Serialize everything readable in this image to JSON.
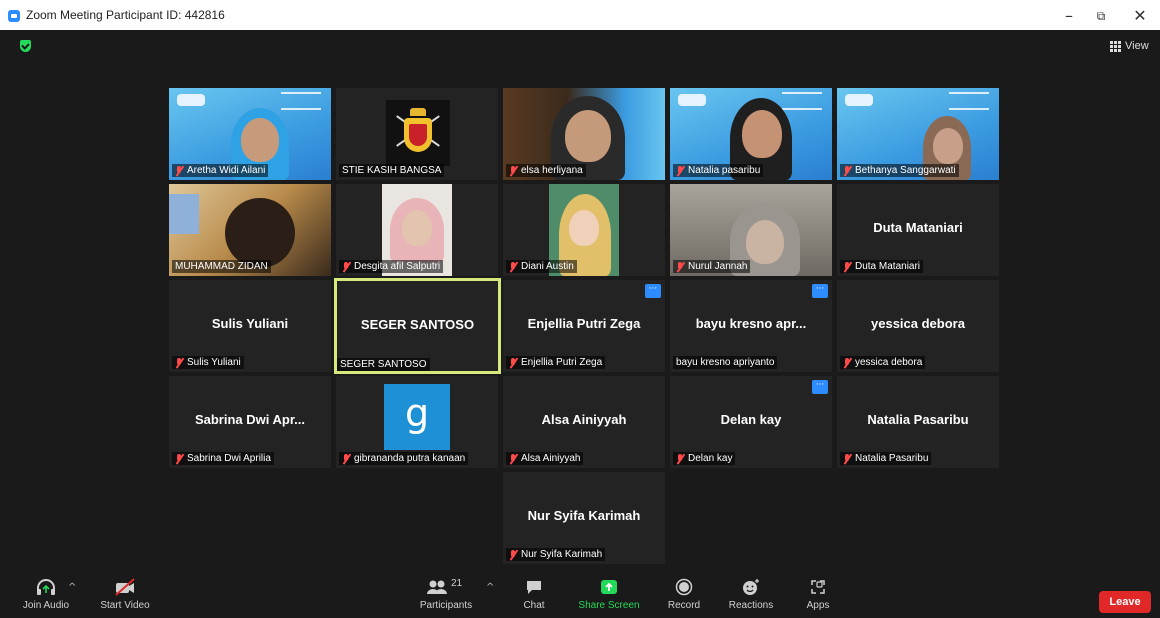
{
  "window": {
    "title": "Zoom Meeting Participant ID: 442816",
    "controls": {
      "minimize": "–",
      "restore": "⧉",
      "close": "✕"
    }
  },
  "header": {
    "view_label": "View"
  },
  "participants": [
    {
      "label": "Aretha Widi Ailani",
      "muted": true,
      "video": "slide"
    },
    {
      "label": "STIE KASIH BANGSA",
      "muted": false,
      "video": "emblem"
    },
    {
      "label": "elsa herliyana",
      "muted": true,
      "video": "camera"
    },
    {
      "label": "Natalia pasaribu",
      "muted": true,
      "video": "slide"
    },
    {
      "label": "Bethanya Sanggarwati",
      "muted": true,
      "video": "slide"
    },
    {
      "label": "MUHAMMAD ZIDAN",
      "muted": false,
      "video": "camera"
    },
    {
      "label": "Desgita afil Salputri",
      "muted": true,
      "video": "camera"
    },
    {
      "label": "Diani Austin",
      "muted": true,
      "video": "camera"
    },
    {
      "label": "Nurul Jannah",
      "muted": true,
      "video": "camera"
    },
    {
      "display_name": "Duta Mataniari",
      "label": "Duta Mataniari",
      "muted": true
    },
    {
      "display_name": "Sulis Yuliani",
      "label": "Sulis Yuliani",
      "muted": true
    },
    {
      "display_name": "SEGER SANTOSO",
      "label": "SEGER SANTOSO",
      "muted": false,
      "active_speaker": true
    },
    {
      "display_name": "Enjellia Putri Zega",
      "label": "Enjellia Putri Zega",
      "muted": true,
      "more_button": "···"
    },
    {
      "display_name": "bayu kresno apr...",
      "label": "bayu kresno apriyanto",
      "muted": false,
      "more_button": "···"
    },
    {
      "display_name": "yessica debora",
      "label": "yessica debora",
      "muted": true
    },
    {
      "display_name": "Sabrina Dwi Apr...",
      "label": "Sabrina Dwi Aprilia",
      "muted": true
    },
    {
      "avatar_letter": "g",
      "label": "gibrananda putra kanaan",
      "muted": true
    },
    {
      "display_name": "Alsa Ainiyyah",
      "label": "Alsa Ainiyyah",
      "muted": true
    },
    {
      "display_name": "Delan kay",
      "label": "Delan kay",
      "muted": true,
      "more_button": "···"
    },
    {
      "display_name": "Natalia Pasaribu",
      "label": "Natalia Pasaribu",
      "muted": true
    },
    {
      "display_name": "Nur Syifa Karimah",
      "label": "Nur Syifa Karimah",
      "muted": true
    }
  ],
  "toolbar": {
    "join_audio": "Join Audio",
    "start_video": "Start Video",
    "participants": "Participants",
    "participant_count": "21",
    "chat": "Chat",
    "share_screen": "Share Screen",
    "record": "Record",
    "reactions": "Reactions",
    "apps": "Apps",
    "leave": "Leave",
    "caret": "^"
  },
  "colors": {
    "background": "#1a1a1a",
    "tile": "#232323",
    "active_speaker_border": "#d6e97c",
    "muted_icon": "#ff4a4a",
    "share_green": "#23d959",
    "leave_red": "#e02828",
    "accent_blue": "#2d8cff"
  }
}
